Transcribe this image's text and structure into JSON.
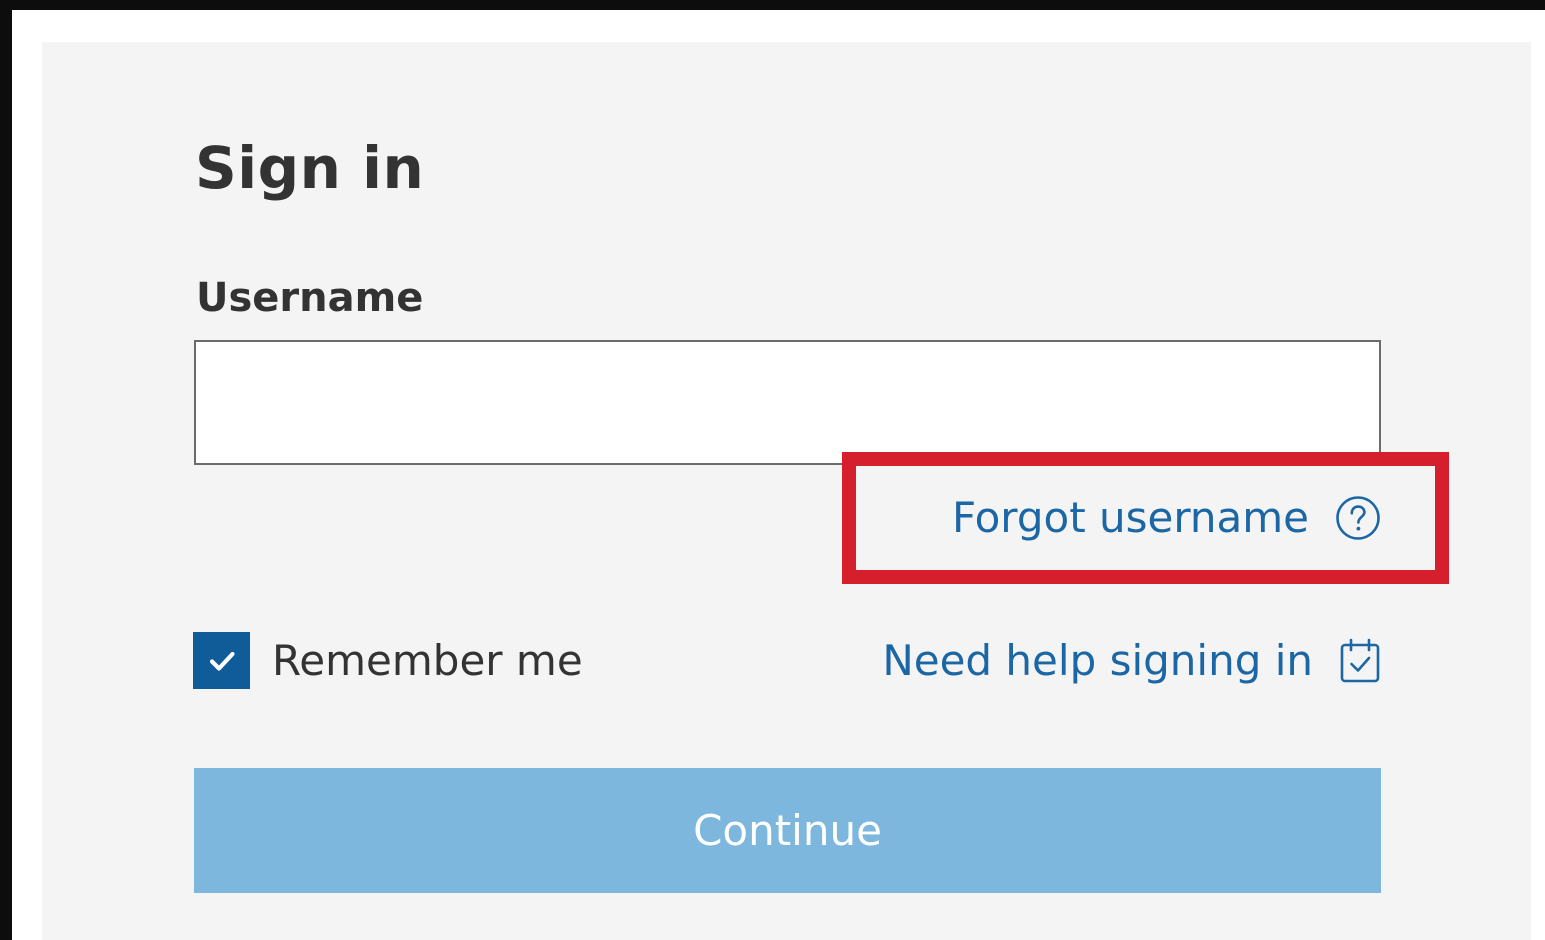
{
  "signin": {
    "title": "Sign in",
    "username_label": "Username",
    "username_value": "",
    "forgot_username_label": "Forgot username",
    "forgot_username_icon": "help-circle-icon",
    "remember_me_label": "Remember me",
    "remember_me_checked": true,
    "need_help_label": "Need help signing in",
    "need_help_icon": "calendar-check-icon",
    "continue_label": "Continue"
  },
  "colors": {
    "link": "#1b66a4",
    "checkbox": "#0f5c99",
    "continue_button": "#7db7de",
    "highlight": "#d61f2c",
    "panel_background": "#f4f4f4"
  }
}
